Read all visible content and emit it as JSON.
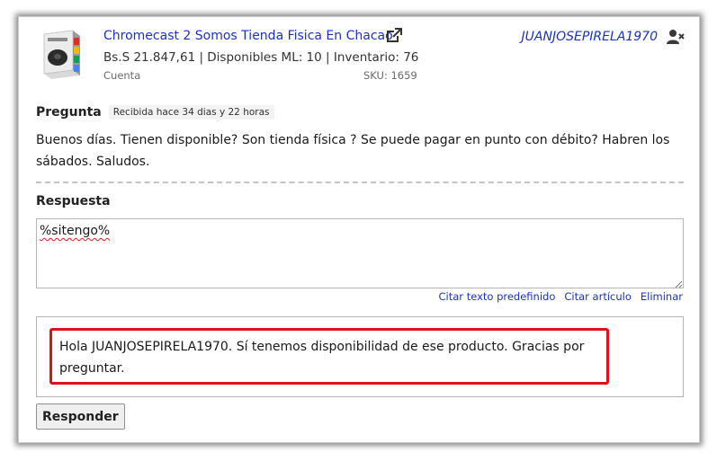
{
  "product": {
    "title": "Chromecast 2 Somos Tienda Fisica En Chacao",
    "price_line": "Bs.S 21.847,61 | Disponibles ML: 10 | Inventario: 76",
    "account_label": "Cuenta",
    "sku": "SKU: 1659",
    "thumbnail_icon": "product-box-icon",
    "external_link_icon": "external-link-icon"
  },
  "buyer": {
    "nickname": "JUANJOSEPIRELA1970",
    "block_icon": "user-x-icon"
  },
  "question": {
    "label": "Pregunta",
    "received": "Recibida hace 34 dias y 22 horas",
    "text": "Buenos días. Tienen disponible? Son tienda física ? Se puede pagar en punto con débito? Habren los sábados. Saludos."
  },
  "answer": {
    "label": "Respuesta",
    "value": "%sitengo%",
    "links": [
      "Citar texto predefinido",
      "Citar artículo",
      "Eliminar"
    ],
    "preview": "Hola JUANJOSEPIRELA1970. Sí tenemos disponibilidad de ese producto. Gracias por preguntar.",
    "submit_label": "Responder"
  },
  "colors": {
    "link": "#1a32c8",
    "highlight": "#e0101a"
  }
}
